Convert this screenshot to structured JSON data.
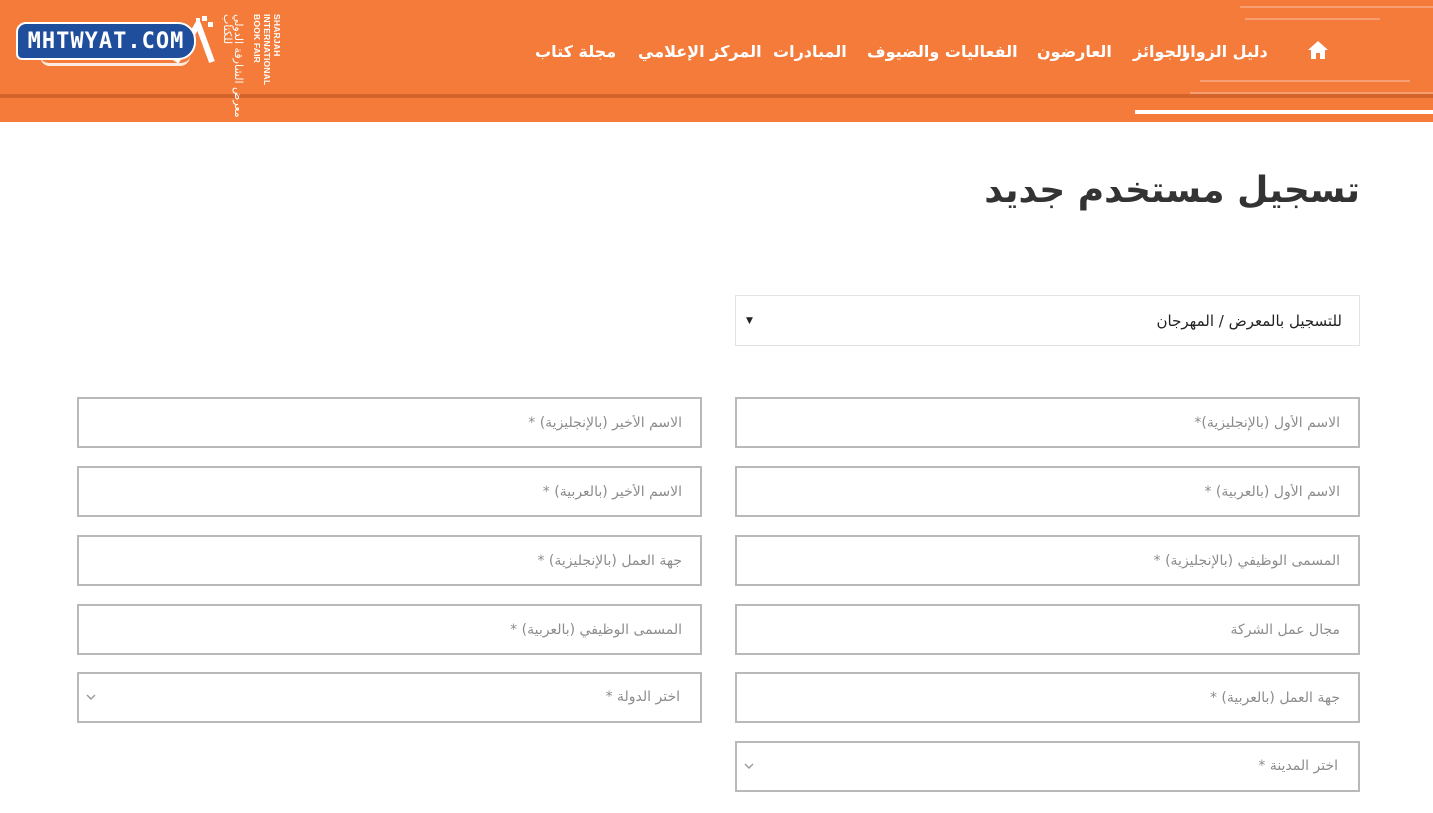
{
  "header": {
    "logo_text": "MHTWYAT.COM",
    "fair_name_arabic": "معرض الشارقة الدولي للكتاب",
    "fair_name_english": [
      "SHARJAH",
      "INTERNATIONAL",
      "BOOK FAIR"
    ],
    "nav": [
      {
        "label": "دليل الزوار",
        "active": true
      },
      {
        "label": "الجوائز"
      },
      {
        "label": "العارضون"
      },
      {
        "label": "الفعاليات والضيوف"
      },
      {
        "label": "المبادرات"
      },
      {
        "label": "المركز الإعلامي"
      },
      {
        "label": "مجلة كتاب"
      }
    ],
    "colors": {
      "bar": "#f47b3a",
      "logo_bg": "#1f4f9c"
    }
  },
  "main": {
    "title": "تسجيل مستخدم جديد",
    "registration_type": {
      "selected": "للتسجيل بالمعرض / المهرجان"
    },
    "fields": {
      "first_name_en": "الاسم الأول (بالإنجليزية)*",
      "last_name_en": "الاسم الأخير (بالإنجليزية) *",
      "first_name_ar": "الاسم الأول (بالعربية) *",
      "last_name_ar": "الاسم الأخير (بالعربية) *",
      "job_title_en": "المسمى الوظيفي (بالإنجليزية) *",
      "employer_en": "جهة العمل (بالإنجليزية) *",
      "company_field": "مجال عمل الشركة",
      "job_title_ar": "المسمى الوظيفي (بالعربية) *",
      "employer_ar": "جهة العمل (بالعربية) *",
      "country_select": "اختر الدولة *",
      "city_select": "اختر المدينة *"
    }
  }
}
